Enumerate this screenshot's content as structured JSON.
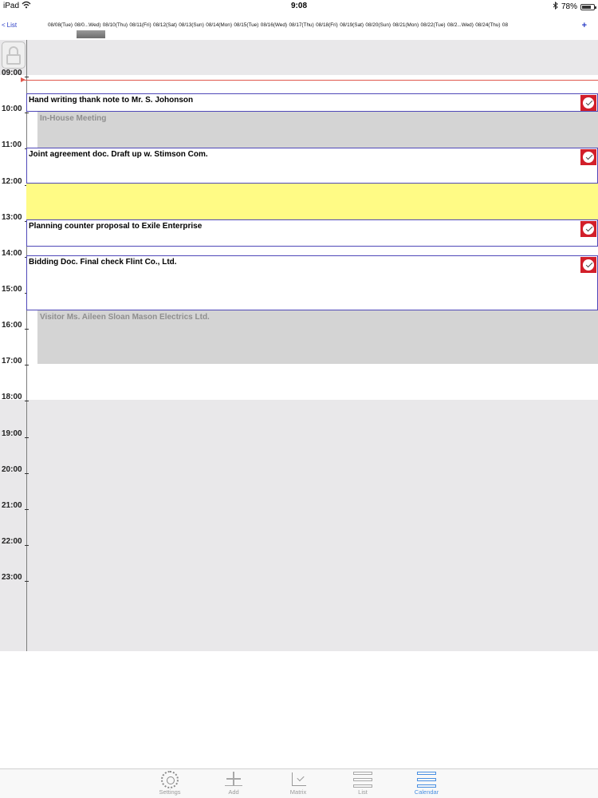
{
  "status": {
    "device": "iPad",
    "time": "9:08",
    "battery": "78%",
    "battery_level": 0.78
  },
  "nav": {
    "back_label": "List",
    "add_label": "+",
    "dates": [
      "08/08(Tue)",
      "08/0...Wed)",
      "08/10(Thu)",
      "08/11(Fri)",
      "08/12(Sat)",
      "08/13(Sun)",
      "08/14(Mon)",
      "08/15(Tue)",
      "08/16(Wed)",
      "08/17(Thu)",
      "08/18(Fri)",
      "08/19(Sat)",
      "08/20(Sun)",
      "08/21(Mon)",
      "08/22(Tue)",
      "08/2...Wed)",
      "08/24(Thu)",
      "08"
    ],
    "selected_index": 1
  },
  "calendar": {
    "hours": [
      "09:00",
      "10:00",
      "11:00",
      "12:00",
      "13:00",
      "14:00",
      "15:00",
      "16:00",
      "17:00",
      "18:00",
      "19:00",
      "20:00",
      "21:00",
      "22:00",
      "23:00"
    ],
    "events": [
      {
        "kind": "task",
        "label": "Hand writing thank note to Mr. S. Johonson",
        "checked": true
      },
      {
        "kind": "meeting",
        "label": "In-House Meeting"
      },
      {
        "kind": "task",
        "label": "Joint agreement doc. Draft up w. Stimson Com.",
        "checked": true
      },
      {
        "kind": "highlight",
        "label": ""
      },
      {
        "kind": "task",
        "label": "Planning counter proposal to Exile Enterprise",
        "checked": true
      },
      {
        "kind": "task",
        "label": "Bidding Doc. Final check Flint Co., Ltd.",
        "checked": true
      },
      {
        "kind": "meeting",
        "label": "Visitor Ms. Aileen Sloan Mason Electrics Ltd."
      }
    ]
  },
  "tabs": [
    {
      "label": "Settings",
      "icon": "gear-icon"
    },
    {
      "label": "Add",
      "icon": "plus-icon"
    },
    {
      "label": "Matrix",
      "icon": "matrix-icon"
    },
    {
      "label": "List",
      "icon": "list-icon"
    },
    {
      "label": "Calendar",
      "icon": "calendar-icon",
      "active": true
    }
  ],
  "colors": {
    "accent": "#2b3ec6",
    "now_line": "#e0584d",
    "task_border": "#4f48b8",
    "check_bg": "#d21f2a",
    "meeting_bg": "#d4d4d4",
    "highlight_bg": "#fffb85",
    "tab_active": "#4a90e2"
  }
}
